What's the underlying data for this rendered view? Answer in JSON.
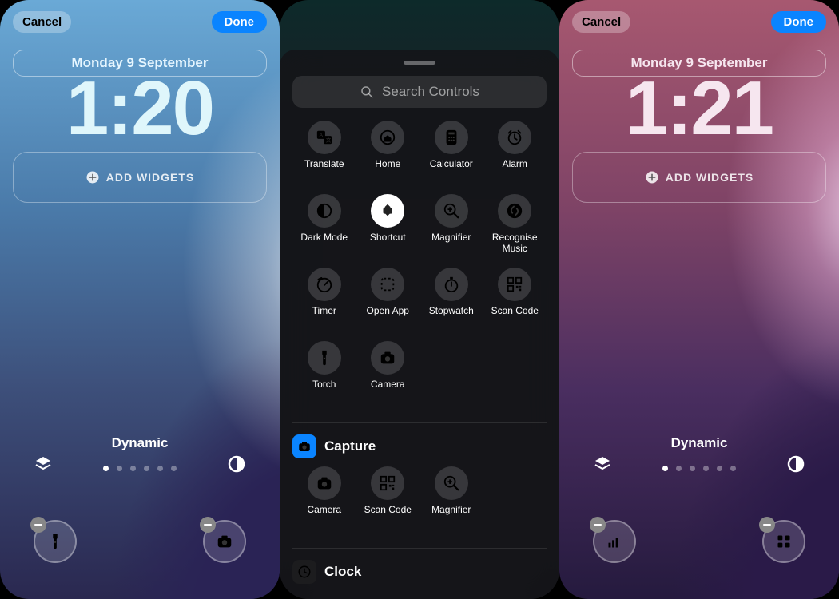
{
  "screens": {
    "left": {
      "cancel": "Cancel",
      "done": "Done",
      "date": "Monday 9 September",
      "time": "1:20",
      "add_widgets": "ADD WIDGETS",
      "quick_label": "Dynamic",
      "dots": 6,
      "dot_active": 0,
      "left_quick_icon": "torch-icon",
      "right_quick_icon": "camera-icon"
    },
    "right": {
      "cancel": "Cancel",
      "done": "Done",
      "date": "Monday 9 September",
      "time": "1:21",
      "add_widgets": "ADD WIDGETS",
      "quick_label": "Dynamic",
      "dots": 6,
      "dot_active": 0,
      "left_quick_icon": "cellular-icon",
      "right_quick_icon": "grid-icon"
    }
  },
  "controls_sheet": {
    "search_placeholder": "Search Controls",
    "suggested": [
      {
        "label": "Translate",
        "icon": "translate-icon",
        "bubble": "dark"
      },
      {
        "label": "Home",
        "icon": "home-icon",
        "bubble": "dark"
      },
      {
        "label": "Calculator",
        "icon": "calculator-icon",
        "bubble": "dark"
      },
      {
        "label": "Alarm",
        "icon": "alarm-icon",
        "bubble": "dark"
      },
      {
        "label": "Dark Mode",
        "icon": "darkmode-icon",
        "bubble": "dark"
      },
      {
        "label": "Shortcut",
        "icon": "shortcut-icon",
        "bubble": "white"
      },
      {
        "label": "Magnifier",
        "icon": "magnifier-icon",
        "bubble": "dark"
      },
      {
        "label": "Recognise Music",
        "icon": "shazam-icon",
        "bubble": "dark"
      },
      {
        "label": "Timer",
        "icon": "timer-icon",
        "bubble": "dark"
      },
      {
        "label": "Open App",
        "icon": "openapp-icon",
        "bubble": "dark"
      },
      {
        "label": "Stopwatch",
        "icon": "stopwatch-icon",
        "bubble": "dark"
      },
      {
        "label": "Scan Code",
        "icon": "qrcode-icon",
        "bubble": "dark"
      },
      {
        "label": "Torch",
        "icon": "torch-icon",
        "bubble": "dark"
      },
      {
        "label": "Camera",
        "icon": "camera-icon",
        "bubble": "dark"
      }
    ],
    "sections": [
      {
        "title": "Capture",
        "icon": "camera-icon",
        "items": [
          {
            "label": "Camera",
            "icon": "camera-icon"
          },
          {
            "label": "Scan Code",
            "icon": "qrcode-icon"
          },
          {
            "label": "Magnifier",
            "icon": "magnifier-icon"
          }
        ]
      },
      {
        "title": "Clock",
        "icon": "clock-icon",
        "items": []
      }
    ]
  }
}
